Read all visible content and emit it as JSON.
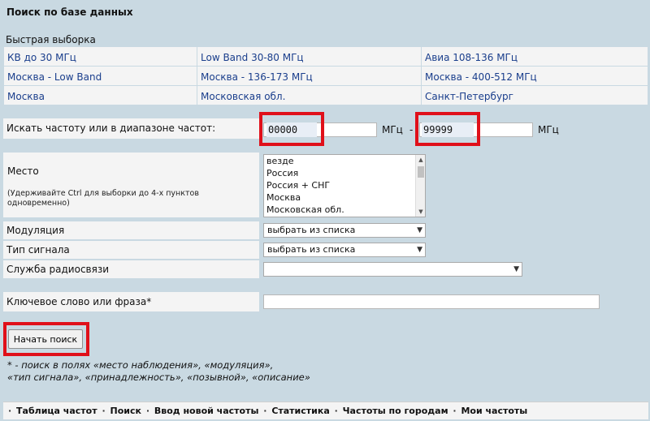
{
  "page": {
    "title": "Поиск по базе данных"
  },
  "quick": {
    "label": "Быстрая выборка",
    "rows": [
      [
        "КВ до 30 МГц",
        "Low Band 30-80 МГц",
        "Авиа 108-136 МГц"
      ],
      [
        "Москва - Low Band",
        "Москва - 136-173 МГц",
        "Москва - 400-512 МГц"
      ],
      [
        "Москва",
        "Московская обл.",
        "Санкт-Петербург"
      ]
    ]
  },
  "freq": {
    "label": "Искать частоту или в диапазоне частот:",
    "from_value": "00000",
    "to_value": "99999",
    "unit": "МГц",
    "dash": "-"
  },
  "place": {
    "label": "Место",
    "hint": "(Удерживайте Ctrl для выборки до 4-х пунктов одновременно)",
    "options": [
      "везде",
      "Россия",
      "Россия + СНГ",
      "Москва",
      "Московская обл."
    ]
  },
  "modulation": {
    "label": "Модуляция",
    "selected": "выбрать из списка"
  },
  "signal": {
    "label": "Тип сигнала",
    "selected": "выбрать из списка"
  },
  "service": {
    "label": "Служба радиосвязи",
    "selected": ""
  },
  "keyword": {
    "label": "Ключевое слово или фраза*",
    "value": ""
  },
  "search_button": "Начать поиск",
  "note": {
    "line1": "* - поиск в полях «место наблюдения», «модуляция»,",
    "line2": "«тип сигнала», «принадлежность», «позывной», «описание»"
  },
  "footer": {
    "sep": "·",
    "links": [
      "Таблица частот",
      "Поиск",
      "Ввод новой частоты",
      "Статистика",
      "Частоты по городам",
      "Мои частоты"
    ]
  },
  "colors": {
    "background": "#c9d9e2",
    "link": "#1a3e8c",
    "highlight": "#e0101a"
  }
}
